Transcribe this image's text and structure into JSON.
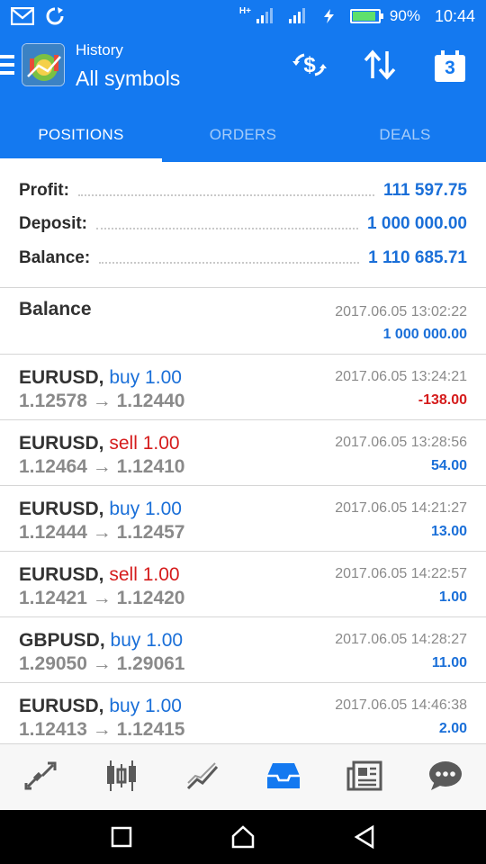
{
  "status_bar": {
    "network": "H+",
    "battery_percent": "90%",
    "battery_level": 0.9,
    "time": "10:44"
  },
  "header": {
    "subtitle": "History",
    "title": "All symbols",
    "calendar_day": "3"
  },
  "tabs": [
    {
      "label": "POSITIONS",
      "active": true
    },
    {
      "label": "ORDERS",
      "active": false
    },
    {
      "label": "DEALS",
      "active": false
    }
  ],
  "summary": {
    "profit_label": "Profit:",
    "profit_value": "111 597.75",
    "deposit_label": "Deposit:",
    "deposit_value": "1 000 000.00",
    "balance_label": "Balance:",
    "balance_value": "1 110 685.71"
  },
  "balance_entry": {
    "label": "Balance",
    "time": "2017.06.05 13:02:22",
    "amount": "1 000 000.00"
  },
  "deals": [
    {
      "symbol": "EURUSD,",
      "direction": "buy 1.00",
      "type": "buy",
      "prices": "1.12578 → 1.12440",
      "time": "2017.06.05 13:24:21",
      "profit": "-138.00",
      "sign": "neg"
    },
    {
      "symbol": "EURUSD,",
      "direction": "sell 1.00",
      "type": "sell",
      "prices": "1.12464 → 1.12410",
      "time": "2017.06.05 13:28:56",
      "profit": "54.00",
      "sign": "pos"
    },
    {
      "symbol": "EURUSD,",
      "direction": "buy 1.00",
      "type": "buy",
      "prices": "1.12444 → 1.12457",
      "time": "2017.06.05 14:21:27",
      "profit": "13.00",
      "sign": "pos"
    },
    {
      "symbol": "EURUSD,",
      "direction": "sell 1.00",
      "type": "sell",
      "prices": "1.12421 → 1.12420",
      "time": "2017.06.05 14:22:57",
      "profit": "1.00",
      "sign": "pos"
    },
    {
      "symbol": "GBPUSD,",
      "direction": "buy 1.00",
      "type": "buy",
      "prices": "1.29050 → 1.29061",
      "time": "2017.06.05 14:28:27",
      "profit": "11.00",
      "sign": "pos"
    },
    {
      "symbol": "EURUSD,",
      "direction": "buy 1.00",
      "type": "buy",
      "prices": "1.12413 → 1.12415",
      "time": "2017.06.05 14:46:38",
      "profit": "2.00",
      "sign": "pos"
    }
  ],
  "bottom_nav": [
    {
      "icon": "quotes-icon",
      "active": false
    },
    {
      "icon": "chart-icon",
      "active": false
    },
    {
      "icon": "trade-icon",
      "active": false
    },
    {
      "icon": "history-icon",
      "active": true
    },
    {
      "icon": "news-icon",
      "active": false
    },
    {
      "icon": "messages-icon",
      "active": false
    }
  ],
  "colors": {
    "accent": "#1479f0",
    "positive": "#1a6fd8",
    "negative": "#d51c1c",
    "nav_inactive": "#5a5a5a"
  }
}
